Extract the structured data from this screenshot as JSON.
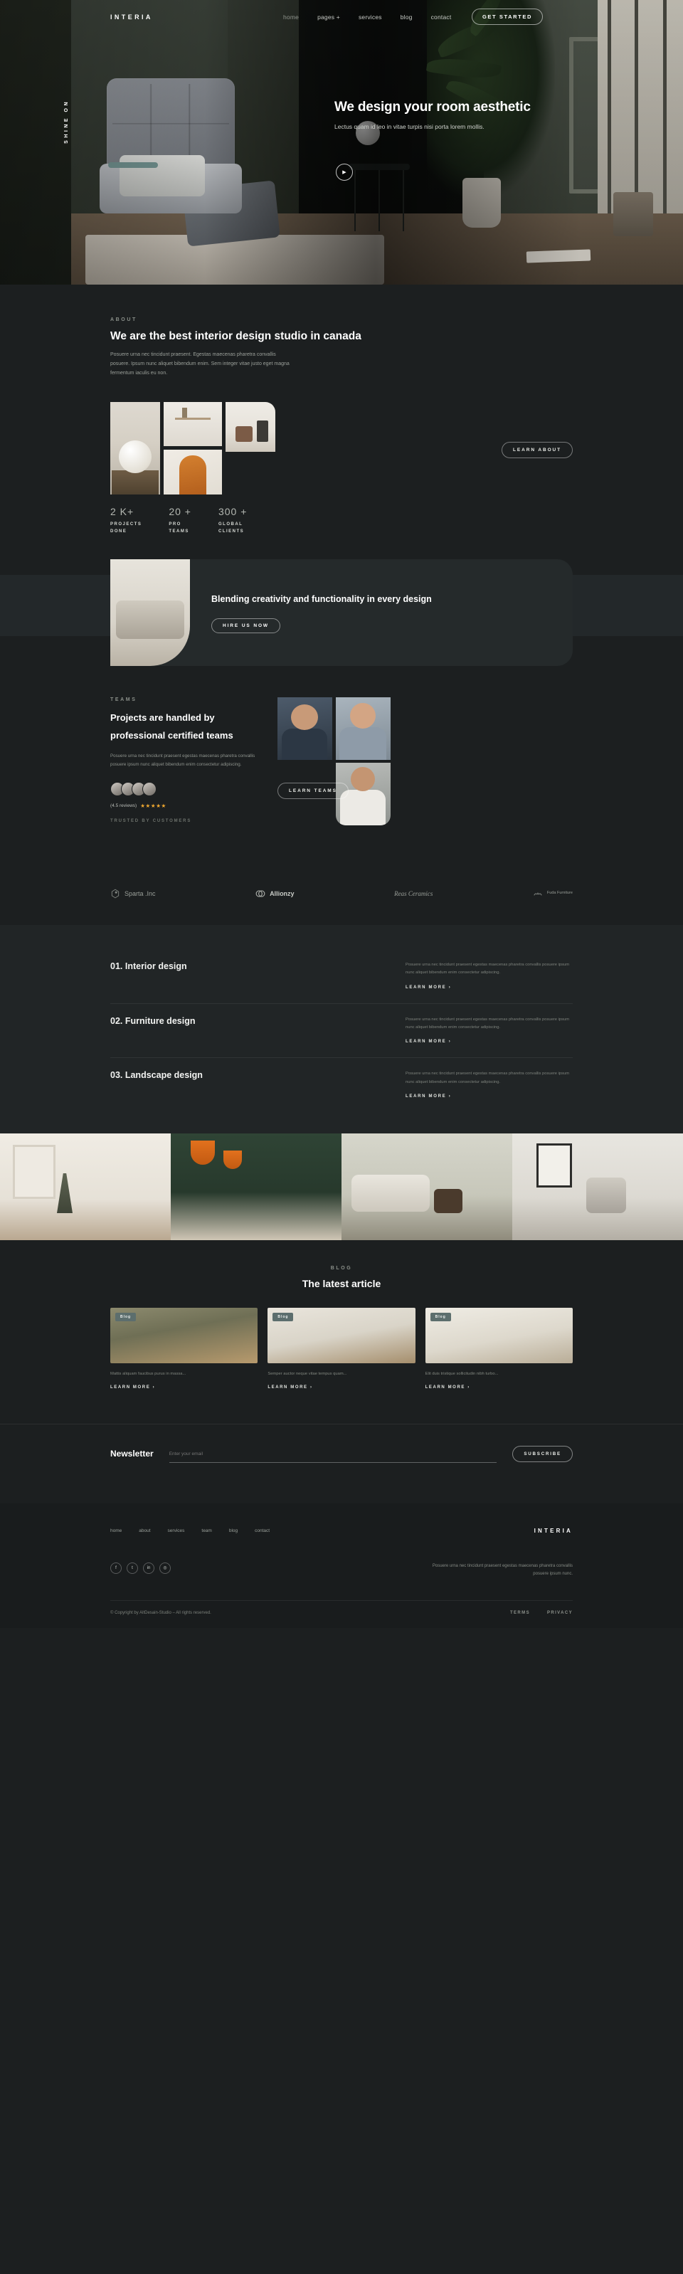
{
  "nav": {
    "brand": "INTERIA",
    "links": [
      {
        "label": "home"
      },
      {
        "label": "pages +"
      },
      {
        "label": "services"
      },
      {
        "label": "blog"
      },
      {
        "label": "contact"
      }
    ],
    "cta": "GET STARTED"
  },
  "hero": {
    "side_word": "SHINE ON",
    "title": "We design your room aesthetic",
    "subtitle": "Lectus quam id leo in vitae turpis nisi porta lorem mollis.",
    "play_icon": "play-icon"
  },
  "about": {
    "eyebrow": "ABOUT",
    "title": "We are the best interior design studio in canada",
    "paragraph": "Posuere urna nec tincidunt praesent. Egestas maecenas pharetra convallis posuere. Ipsum nunc aliquet bibendum enim. Sem integer vitae justo eget magna fermentum iaculis eu non.",
    "button": "LEARN ABOUT",
    "stats": [
      {
        "num": "2 K+",
        "label": "PROJECTS\nDONE"
      },
      {
        "num": "20 +",
        "label": "PRO\nTEAMS"
      },
      {
        "num": "300 +",
        "label": "GLOBAL\nCLIENTS"
      }
    ]
  },
  "banner": {
    "title": "Blending creativity and functionality in every design",
    "button": "HIRE US NOW"
  },
  "teams": {
    "eyebrow": "TEAMS",
    "title": "Projects are handled by professional certified teams",
    "paragraph": "Posuere urna nec tincidunt praesent egestas maecenas pharetra convallis posuere ipsum nunc aliquet bibendum enim consectetur adipiscing.",
    "reviews": "(4.5 reviews)",
    "stars": "★★★★★",
    "trusted": "TRUSTED BY CUSTOMERS",
    "button": "LEARN TEAMS"
  },
  "brands": [
    {
      "name": "Sparta .Inc",
      "icon": "sparta-logo-icon"
    },
    {
      "name": "Allionzy",
      "icon": "allionzy-logo-icon"
    },
    {
      "name": "Reas Ceramics",
      "icon": "reas-ceramics-logo-icon"
    },
    {
      "name": "Fuda Furniture",
      "icon": "fuda-logo-icon"
    }
  ],
  "services": [
    {
      "title": "01. Interior design",
      "desc": "Posuere urna nec tincidunt praesent egestas maecenas pharetra convallis posuere ipsum nunc aliquet bibendum enim consectetur adipiscing.",
      "more": "LEARN MORE"
    },
    {
      "title": "02. Furniture design",
      "desc": "Posuere urna nec tincidunt praesent egestas maecenas pharetra convallis posuere ipsum nunc aliquet bibendum enim consectetur adipiscing.",
      "more": "LEARN MORE"
    },
    {
      "title": "03. Landscape design",
      "desc": "Posuere urna nec tincidunt praesent egestas maecenas pharetra convallis posuere ipsum nunc aliquet bibendum enim consectetur adipiscing.",
      "more": "LEARN MORE"
    }
  ],
  "blog": {
    "eyebrow": "BLOG",
    "title": "The latest article",
    "cards": [
      {
        "tag": "Blog",
        "excerpt": "Mattis aliquam faucibus purus in massa...",
        "more": "LEARN MORE"
      },
      {
        "tag": "Blog",
        "excerpt": "Semper auctor neque vitae tempus quam...",
        "more": "LEARN MORE"
      },
      {
        "tag": "Blog",
        "excerpt": "Elit duis tristique sollicitudin nibh turbo...",
        "more": "LEARN MORE"
      }
    ]
  },
  "newsletter": {
    "title": "Newsletter",
    "placeholder": "Enter your email",
    "button": "SUBSCRIBE"
  },
  "footer": {
    "nav": [
      {
        "label": "home"
      },
      {
        "label": "about"
      },
      {
        "label": "services"
      },
      {
        "label": "team"
      },
      {
        "label": "blog"
      },
      {
        "label": "contact"
      }
    ],
    "brand": "INTERIA",
    "socials": [
      {
        "icon": "facebook-icon",
        "glyph": "f"
      },
      {
        "icon": "twitter-icon",
        "glyph": "t"
      },
      {
        "icon": "linkedin-icon",
        "glyph": "in"
      },
      {
        "icon": "instagram-icon",
        "glyph": "◎"
      }
    ],
    "text": "Posuere urna nec tincidunt praesent egestas maecenas pharetra convallis posuere ipsum nunc.",
    "copyright": "© Copyright by AltDesain-Studio – All rights reserved.",
    "links": [
      {
        "label": "TERMS"
      },
      {
        "label": "PRIVACY"
      }
    ]
  },
  "colors": {
    "bg": "#1c1f20",
    "panel": "#212526",
    "footer": "#191c1d",
    "accent_star": "#f0a830",
    "tag": "#5c6e6d"
  }
}
